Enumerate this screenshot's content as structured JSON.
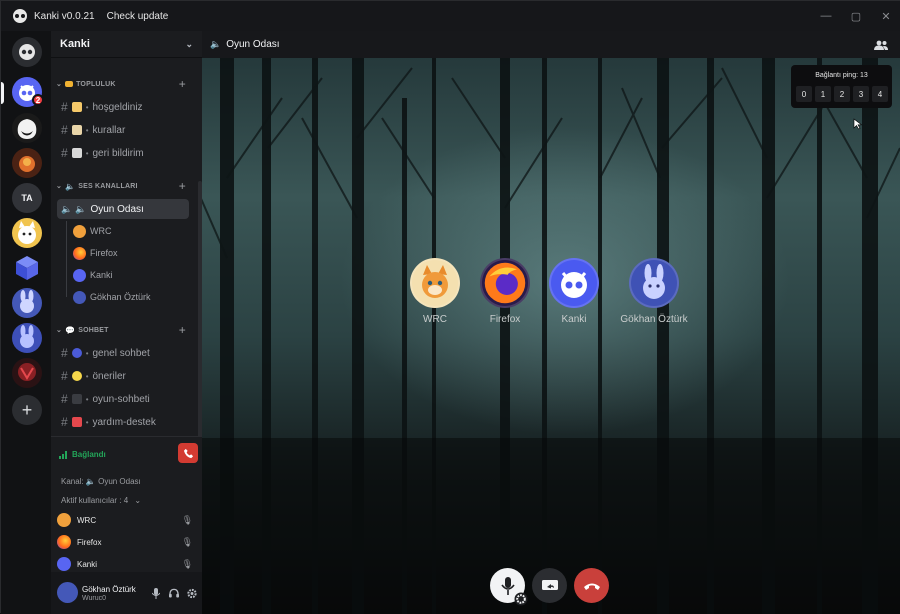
{
  "window": {
    "title": "Kanki v0.0.21",
    "check_update": "Check update",
    "controls": [
      "minimize",
      "maximize",
      "close"
    ]
  },
  "servers": {
    "items": [
      {
        "name": "home-kanki",
        "initials": ""
      },
      {
        "name": "kanki-server",
        "initials": "",
        "badge": "2"
      },
      {
        "name": "server-2",
        "initials": ""
      },
      {
        "name": "server-3",
        "initials": ""
      },
      {
        "name": "server-ta",
        "initials": "TA"
      },
      {
        "name": "server-5",
        "initials": ""
      },
      {
        "name": "server-6",
        "initials": ""
      },
      {
        "name": "server-7",
        "initials": ""
      },
      {
        "name": "server-8",
        "initials": ""
      },
      {
        "name": "server-9",
        "initials": ""
      }
    ],
    "add_label": "+"
  },
  "guild": {
    "name": "Kanki",
    "categories": [
      {
        "name": "TOPLULUK",
        "channels": [
          "hoşgeldiniz",
          "kurallar",
          "geri bildirim"
        ]
      },
      {
        "name": "SES KANALLARI",
        "voice_channel": "Oyun Odası",
        "voice_users": [
          "WRC",
          "Firefox",
          "Kanki",
          "Gökhan Öztürk"
        ]
      },
      {
        "name": "SOHBET",
        "channels": [
          "genel sohbet",
          "öneriler",
          "oyun-sohbeti",
          "yardım-destek"
        ]
      }
    ]
  },
  "voice_panel": {
    "status": "Bağlandı",
    "channel_line": "Kanal: 🔈 Oyun Odası",
    "active_users_label": "Aktif kullanıcılar : 4",
    "users": [
      "WRC",
      "Firefox",
      "Kanki"
    ]
  },
  "user_panel": {
    "name": "Gökhan Öztürk",
    "status": "Wuruc0"
  },
  "main": {
    "channel_title": "Oyun Odası",
    "ping": {
      "title": "Bağlantı ping: 13",
      "cells": [
        "0",
        "1",
        "2",
        "3",
        "4"
      ]
    },
    "participants": [
      "WRC",
      "Firefox",
      "Kanki",
      "Gökhan Öztürk"
    ]
  },
  "colors": {
    "accent": "#5865f2",
    "connected": "#23a559",
    "danger": "#d33b32",
    "badge": "#f23f43"
  }
}
